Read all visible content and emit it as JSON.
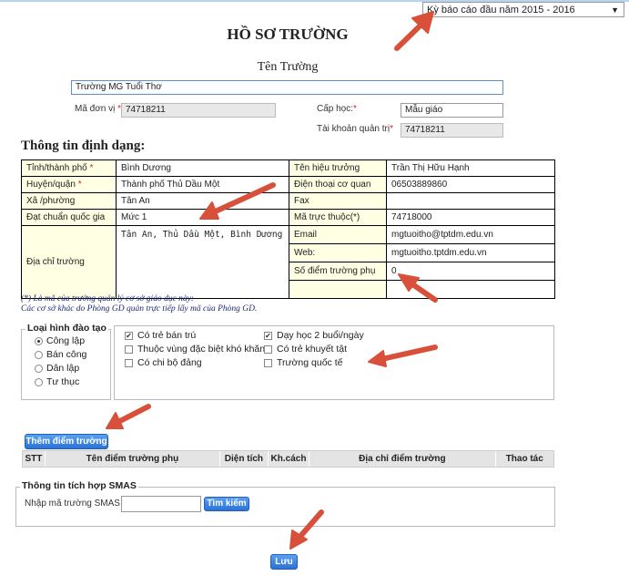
{
  "period_select": {
    "value": "Kỳ báo cáo đầu năm 2015 - 2016"
  },
  "page_title": "HỒ SƠ TRƯỜNG",
  "school_name_label": "Tên Trường",
  "school_name_value": "Trường MG Tuổi Thơ",
  "unit_code": {
    "label": "Mã đơn vị",
    "value": "74718211"
  },
  "level": {
    "label": "Cấp học:",
    "value": "Mẫu giáo"
  },
  "admin_account": {
    "label": "Tài khoản quản trị",
    "value": "74718211"
  },
  "format_section_title": "Thông tin định dạng:",
  "info": {
    "province": {
      "label": "Tỉnh/thành phố",
      "value": "Bình Dương"
    },
    "district": {
      "label": "Huyện/quận",
      "value": "Thành phố Thủ Dầu Một"
    },
    "ward": {
      "label": "Xã /phường",
      "value": "Tân An"
    },
    "standard": {
      "label": "Đạt chuẩn quốc gia",
      "value": "Mức 1"
    },
    "address": {
      "label": "Địa chỉ trường",
      "value": "Tân An, Thủ Dầu Một, Bình Dương"
    },
    "principal": {
      "label": "Tên hiệu trưởng",
      "value": "Trần Thị Hữu Hạnh"
    },
    "phone": {
      "label": "Điện thoại cơ quan",
      "value": "06503889860"
    },
    "fax": {
      "label": "Fax",
      "value": ""
    },
    "parent_code": {
      "label": "Mã trực thuộc(*)",
      "value": "74718000"
    },
    "email": {
      "label": "Email",
      "value": "mgtuoitho@tptdm.edu.vn"
    },
    "web": {
      "label": "Web:",
      "value": "mgtuoitho.tptdm.edu.vn"
    },
    "sub_sites": {
      "label": "Số điểm trường phụ",
      "value": "0"
    }
  },
  "notes": {
    "line1": "(*) Là mã của trường quản lý cơ sở giáo dục này:",
    "line2": "Các cơ sở khác do Phòng GD quản trực tiếp lấy mã của Phòng GD."
  },
  "training_type": {
    "legend": "Loại hình đào tạo",
    "options": [
      "Công lập",
      "Bán công",
      "Dân lập",
      "Tư thục"
    ],
    "selected": "Công lập"
  },
  "features": {
    "c1": [
      {
        "label": "Có trẻ bán trú",
        "checked": true
      },
      {
        "label": "Thuộc vùng đặc biệt khó khăn",
        "checked": false
      },
      {
        "label": "Có chi bộ đảng",
        "checked": false
      }
    ],
    "c2": [
      {
        "label": "Dạy học 2 buổi/ngày",
        "checked": true
      },
      {
        "label": "Có trẻ khuyết tật",
        "checked": false
      },
      {
        "label": "Trường quốc tế",
        "checked": false
      }
    ]
  },
  "add_site_button": "Thêm điểm trường",
  "sites_table": {
    "headers": [
      "STT",
      "Tên điểm trường phụ",
      "Diện tích",
      "Kh.cách",
      "Địa chỉ điểm trường",
      "Thao tác"
    ]
  },
  "smas": {
    "legend": "Thông tin tích hợp SMAS",
    "label": "Nhập mã trường SMAS :",
    "value": "",
    "search_button": "Tìm kiếm"
  },
  "save_button": "Lưu",
  "colors": {
    "annotation_arrow": "#d9503a",
    "button_blue": "#2b72d8",
    "label_cell_bg": "#ffffe3"
  }
}
